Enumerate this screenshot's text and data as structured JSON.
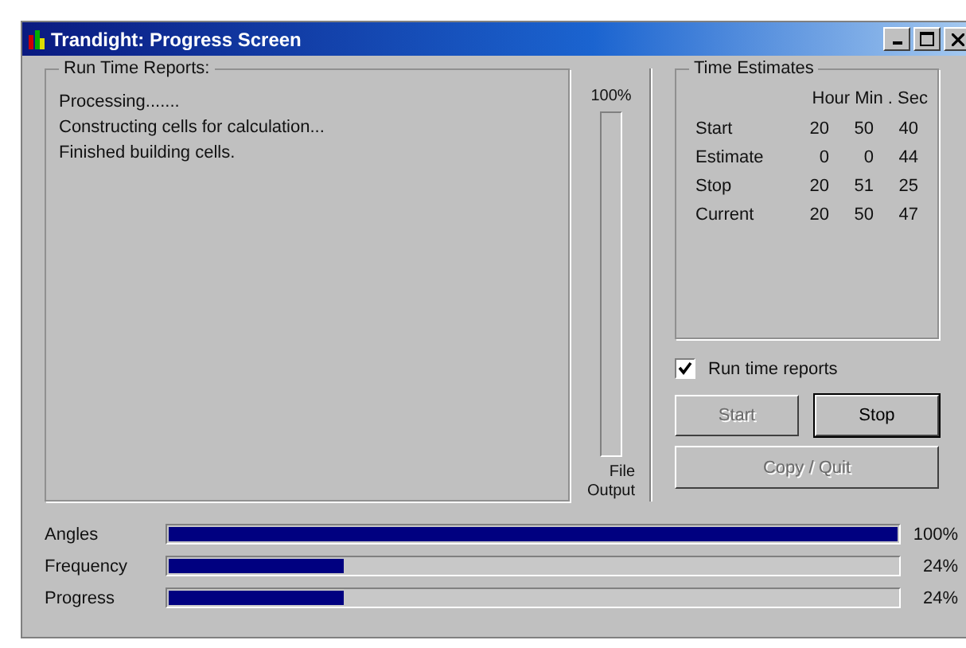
{
  "window": {
    "title": "Trandight: Progress Screen"
  },
  "reports": {
    "title": "Run Time Reports:",
    "lines": [
      "Processing.......",
      "Constructing cells for calculation...",
      "Finished building cells."
    ]
  },
  "file_output": {
    "top_label": "100%",
    "level": 0,
    "bottom_label": "File\nOutput"
  },
  "time_estimates": {
    "title": "Time Estimates",
    "header": "Hour  Min . Sec",
    "rows": [
      {
        "label": "Start",
        "hour": "20",
        "min": "50",
        "sec": "40"
      },
      {
        "label": "Estimate",
        "hour": "0",
        "min": "0",
        "sec": "44"
      },
      {
        "label": "Stop",
        "hour": "20",
        "min": "51",
        "sec": "25"
      },
      {
        "label": "Current",
        "hour": "20",
        "min": "50",
        "sec": "47"
      }
    ]
  },
  "run_time_reports": {
    "label": "Run time reports",
    "checked": true
  },
  "buttons": [
    {
      "label": "Start",
      "disabled": true
    },
    {
      "label": "Stop",
      "disabled": false
    }
  ],
  "copy_quit": {
    "label": "Copy / Quit",
    "disabled": true
  },
  "progress": [
    {
      "label": "Angles",
      "level": 1.0,
      "reading": "100%"
    },
    {
      "label": "Frequency",
      "level": 0.24,
      "reading": "24%"
    },
    {
      "label": "Progress",
      "level": 0.24,
      "reading": "24%"
    }
  ]
}
